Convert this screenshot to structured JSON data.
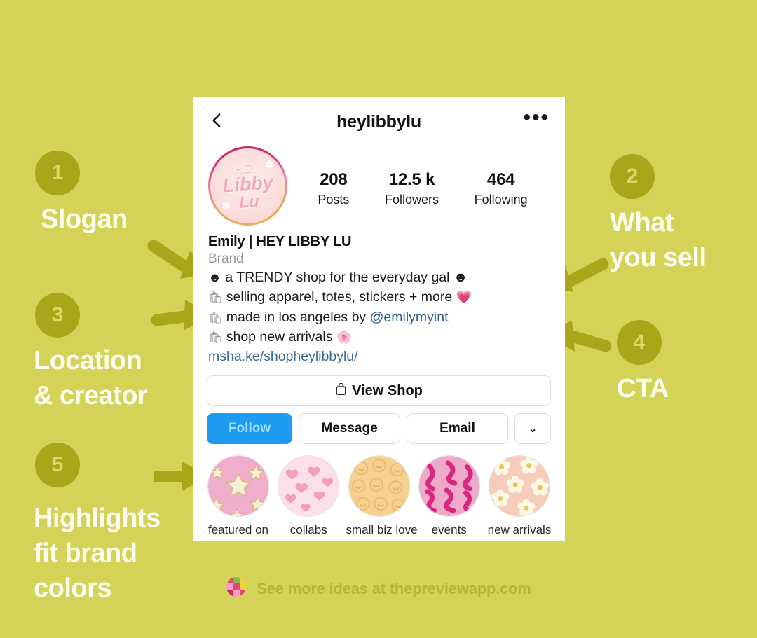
{
  "theme": {
    "background": "#d4d257",
    "badge_bg": "#a9a61a",
    "badge_text": "#dcd96a",
    "label_text": "#fdfdf2",
    "arrow": "#a9a61a",
    "footer_text": "#b6b341",
    "follow_blue": "#1d9bf0"
  },
  "annotations": [
    {
      "number": "1",
      "label": "Slogan"
    },
    {
      "number": "2",
      "label": "What\nyou sell"
    },
    {
      "number": "3",
      "label": "Location\n& creator"
    },
    {
      "number": "4",
      "label": "CTA"
    },
    {
      "number": "5",
      "label": "Highlights\nfit brand\ncolors"
    }
  ],
  "profile": {
    "topbar": {
      "back_icon": "chevron-left-icon",
      "handle": "heylibbylu",
      "more_icon": "more-options-icon",
      "more_glyph": "•••"
    },
    "avatar": {
      "icon": "profile-avatar",
      "logo_line1": "HEY",
      "logo_line2": "Libby",
      "logo_line3": "Lu"
    },
    "stats": [
      {
        "value": "208",
        "label": "Posts"
      },
      {
        "value": "12.5 k",
        "label": "Followers"
      },
      {
        "value": "464",
        "label": "Following"
      }
    ],
    "bio": {
      "name": "Emily | HEY LIBBY LU",
      "category": "Brand",
      "lines": [
        {
          "lead": "☻",
          "text": " a TRENDY shop for the everyday gal ☻",
          "trail": ""
        },
        {
          "lead": "🛍",
          "text": " selling apparel, totes, stickers + more ",
          "trail": "💗"
        },
        {
          "lead": "🛍",
          "text": " made in los angeles by ",
          "mention": "@emilymyint",
          "trail": ""
        },
        {
          "lead": "🛍",
          "text": " shop new arrivals ",
          "trail": "🌸"
        }
      ],
      "link": "msha.ke/shopheylibbylu/"
    },
    "buttons": {
      "view_shop_icon": "shopping-bag-icon",
      "view_shop": "View Shop",
      "follow": "Follow",
      "message": "Message",
      "email": "Email",
      "chevron_icon": "chevron-down-icon",
      "chevron_glyph": "⌄"
    },
    "highlights": [
      {
        "label": "featured on",
        "cover": "stars-on-pink"
      },
      {
        "label": "collabs",
        "cover": "hearts-on-pink"
      },
      {
        "label": "small biz love",
        "cover": "smileys-on-gold"
      },
      {
        "label": "events",
        "cover": "squiggle-smileys-magenta"
      },
      {
        "label": "new arrivals",
        "cover": "daisies-on-peach"
      }
    ]
  },
  "footer": {
    "logo_icon": "preview-app-logo",
    "text": "See more ideas at thepreviewapp.com"
  }
}
